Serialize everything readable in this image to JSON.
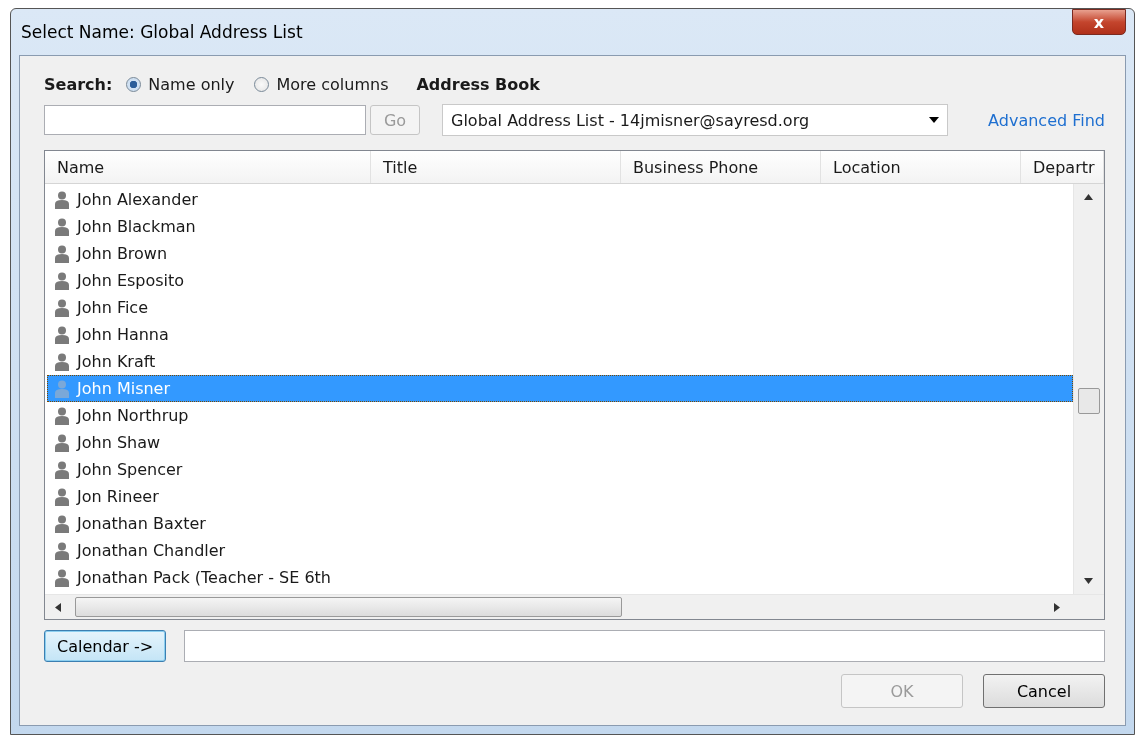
{
  "window": {
    "title": "Select Name: Global Address List",
    "close": "x"
  },
  "search": {
    "label": "Search:",
    "options": [
      {
        "label": "Name only",
        "selected": true
      },
      {
        "label": "More columns",
        "selected": false
      }
    ],
    "go_button": {
      "label": "Go",
      "disabled": true
    }
  },
  "address_book": {
    "label": "Address Book",
    "value": "Global Address List - 14jmisner@sayresd.org"
  },
  "advanced_find": "Advanced Find",
  "table": {
    "columns": [
      "Name",
      "Title",
      "Business Phone",
      "Location",
      "Departr"
    ],
    "rows": [
      {
        "name": "John Alexander",
        "selected": false
      },
      {
        "name": "John Blackman",
        "selected": false
      },
      {
        "name": "John Brown",
        "selected": false
      },
      {
        "name": "John Esposito",
        "selected": false
      },
      {
        "name": "John Fice",
        "selected": false
      },
      {
        "name": "John Hanna",
        "selected": false
      },
      {
        "name": "John Kraft",
        "selected": false
      },
      {
        "name": "John Misner",
        "selected": true
      },
      {
        "name": "John Northrup",
        "selected": false
      },
      {
        "name": "John Shaw",
        "selected": false
      },
      {
        "name": "John Spencer",
        "selected": false
      },
      {
        "name": "Jon Rineer",
        "selected": false
      },
      {
        "name": "Jonathan Baxter",
        "selected": false
      },
      {
        "name": "Jonathan Chandler",
        "selected": false
      },
      {
        "name": "Jonathan Pack (Teacher - SE 6th",
        "selected": false
      }
    ]
  },
  "calendar_button": "Calendar ->",
  "buttons": [
    {
      "label": "OK",
      "disabled": true
    },
    {
      "label": "Cancel",
      "disabled": false
    }
  ]
}
